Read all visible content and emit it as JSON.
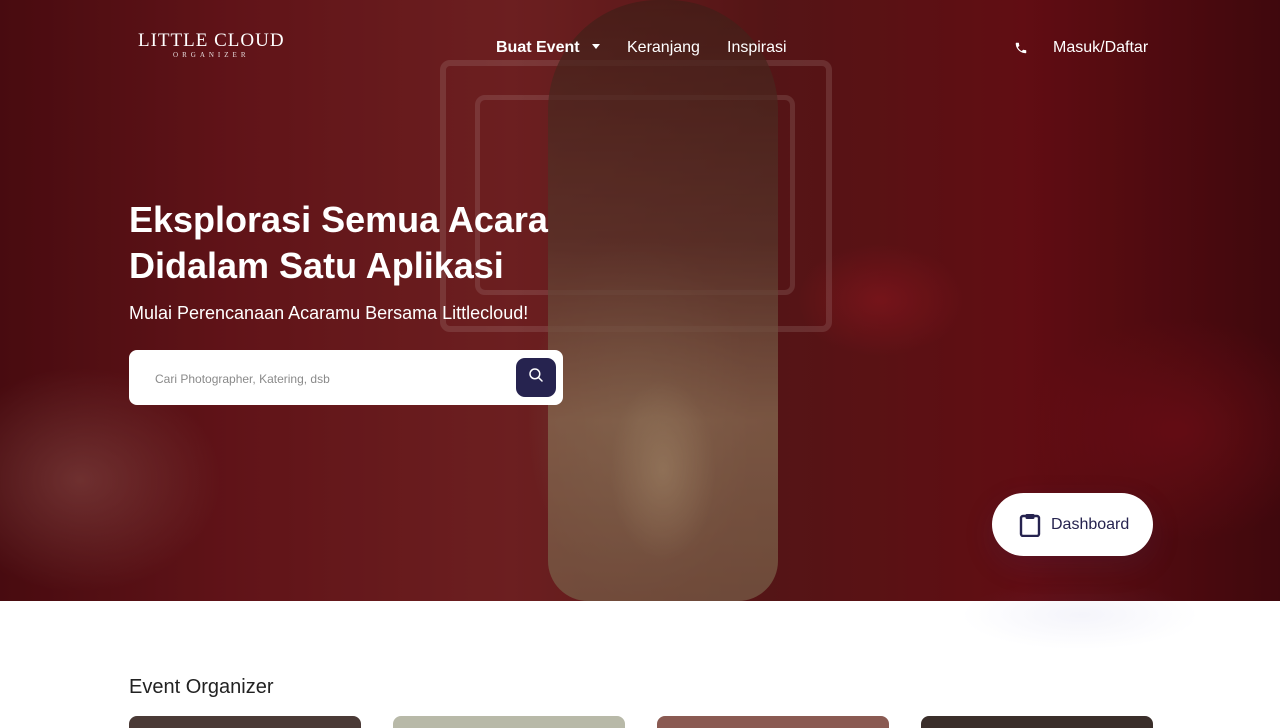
{
  "brand": {
    "name": "LITTLE CLOUD",
    "tagline": "ORGANIZER"
  },
  "nav": {
    "items": [
      {
        "label": "Buat Event",
        "has_dropdown": true
      },
      {
        "label": "Keranjang"
      },
      {
        "label": "Inspirasi"
      }
    ],
    "phone_icon": "phone-icon",
    "auth_label": "Masuk/Daftar"
  },
  "hero": {
    "title_line1": "Eksplorasi Semua Acara",
    "title_line2": "Didalam Satu Aplikasi",
    "subtitle": "Mulai Perencanaan Acaramu Bersama Littlecloud!",
    "search": {
      "placeholder": "Cari Photographer, Katering, dsb",
      "icon": "search-icon"
    }
  },
  "dashboard_button": {
    "label": "Dashboard",
    "icon": "clipboard-icon"
  },
  "sections": {
    "event_organizer_title": "Event Organizer"
  },
  "colors": {
    "accent": "#26234f",
    "white": "#ffffff"
  }
}
